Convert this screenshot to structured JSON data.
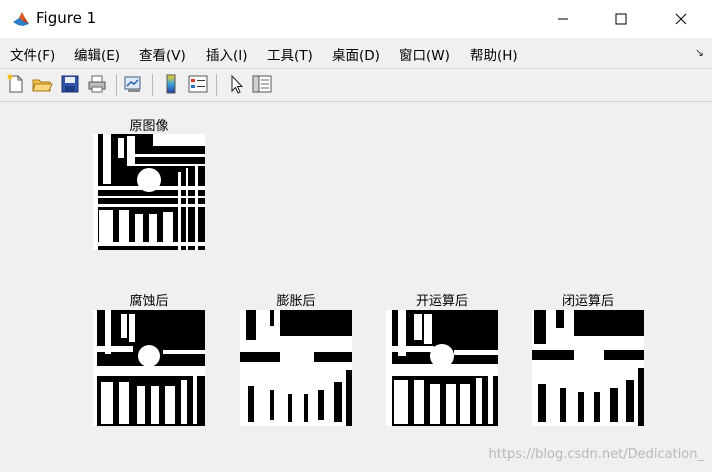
{
  "window": {
    "title": "Figure 1"
  },
  "menu": {
    "items": [
      {
        "label": "文件(F)"
      },
      {
        "label": "编辑(E)"
      },
      {
        "label": "查看(V)"
      },
      {
        "label": "插入(I)"
      },
      {
        "label": "工具(T)"
      },
      {
        "label": "桌面(D)"
      },
      {
        "label": "窗口(W)"
      },
      {
        "label": "帮助(H)"
      }
    ],
    "dock_arrow": "↘"
  },
  "toolbar": {
    "icons": [
      "new-figure-icon",
      "open-file-icon",
      "save-icon",
      "print-icon",
      "link-plot-icon",
      "insert-colorbar-icon",
      "insert-legend-icon",
      "edit-plot-arrow-icon",
      "property-inspector-icon"
    ]
  },
  "axes": [
    {
      "title": "原图像"
    },
    {
      "title": "腐蚀后"
    },
    {
      "title": "膨胀后"
    },
    {
      "title": "开运算后"
    },
    {
      "title": "闭运算后"
    }
  ],
  "watermark": "https://blog.csdn.net/Dedication_",
  "colors": {
    "titlebar": "#ffffff",
    "background": "#f0f0f0",
    "image_fg": "#ffffff",
    "image_bg": "#000000"
  }
}
